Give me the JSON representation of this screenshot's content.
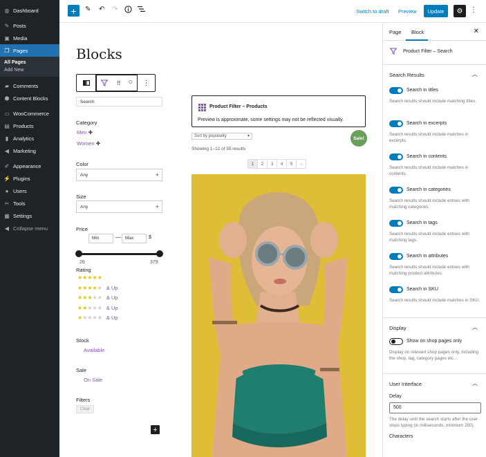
{
  "admin_menu": {
    "items": [
      {
        "label": "Dashboard",
        "icon": "dashboard-icon"
      },
      {
        "label": "Posts",
        "icon": "pin-icon"
      },
      {
        "label": "Media",
        "icon": "media-icon"
      },
      {
        "label": "Pages",
        "icon": "pages-icon"
      },
      {
        "label": "Comments",
        "icon": "comment-icon"
      },
      {
        "label": "Content Blocks",
        "icon": "blocks-icon"
      },
      {
        "label": "WooCommerce",
        "icon": "woo-icon"
      },
      {
        "label": "Products",
        "icon": "archive-icon"
      },
      {
        "label": "Analytics",
        "icon": "bar-chart-icon"
      },
      {
        "label": "Marketing",
        "icon": "megaphone-icon"
      },
      {
        "label": "Appearance",
        "icon": "brush-icon"
      },
      {
        "label": "Plugins",
        "icon": "plug-icon"
      },
      {
        "label": "Users",
        "icon": "user-icon"
      },
      {
        "label": "Tools",
        "icon": "wrench-icon"
      },
      {
        "label": "Settings",
        "icon": "settings-icon"
      },
      {
        "label": "Collapse menu",
        "icon": "collapse-icon"
      }
    ],
    "sub": {
      "all_pages": "All Pages",
      "add_new": "Add New"
    },
    "accent": "#2271b1"
  },
  "toolbar": {
    "switch_to_draft": "Switch to draft",
    "preview": "Preview",
    "update": "Update"
  },
  "editor": {
    "page_title": "Blocks",
    "filters": {
      "search_placeholder": "Search",
      "category": {
        "label": "Category",
        "options": [
          "Men",
          "Women"
        ]
      },
      "color": {
        "label": "Color",
        "value": "Any"
      },
      "size": {
        "label": "Size",
        "value": "Any"
      },
      "price": {
        "label": "Price",
        "min_placeholder": "Min",
        "max_placeholder": "Max",
        "currency": "$",
        "min": "26",
        "max": "379",
        "dash": "—"
      },
      "rating": {
        "label": "Rating",
        "levels": [
          5,
          4,
          3,
          2,
          1
        ],
        "and_up": "& Up"
      },
      "stock": {
        "label": "Stock",
        "option": "Available"
      },
      "sale": {
        "label": "Sale",
        "option": "On Sale"
      },
      "filters": {
        "label": "Filters",
        "clear": "Clear"
      }
    },
    "products_block": {
      "title": "Product Filter – Products",
      "note": "Preview is approximate, some settings may not be reflected visually."
    },
    "sort": "Sort by popularity",
    "sale_badge": "Sale!",
    "showing": "Showing 1–12 of 55 results",
    "pages": [
      "1",
      "2",
      "3",
      "4",
      "5",
      "→"
    ]
  },
  "settings": {
    "tabs": {
      "page": "Page",
      "block": "Block"
    },
    "block_name": "Product Filter – Search",
    "search_results": {
      "title": "Search Results",
      "toggles": [
        {
          "label": "Search in titles",
          "help": "Search results should include matching titles.",
          "on": true
        },
        {
          "label": "Search in excerpts",
          "help": "Search results should include matches in excerpts.",
          "on": true
        },
        {
          "label": "Search in contents",
          "help": "Search results should include matches in contents.",
          "on": true
        },
        {
          "label": "Search in categories",
          "help": "Search results should include entries with matching categories.",
          "on": true
        },
        {
          "label": "Search in tags",
          "help": "Search results should include entries with matching tags.",
          "on": true
        },
        {
          "label": "Search in attributes",
          "help": "Search results should include entries with matching product attributes.",
          "on": true
        },
        {
          "label": "Search in SKU",
          "help": "Search results should include matches in SKU.",
          "on": true
        }
      ]
    },
    "display": {
      "title": "Display",
      "toggle_label": "Show on shop pages only",
      "toggle_help": "Display on relevant shop pages only, including the shop, tag, category pages etc…",
      "on": false
    },
    "ui": {
      "title": "User Interface",
      "delay_label": "Delay",
      "delay_value": "500",
      "delay_help": "The delay until the search starts after the user stops typing (in milliseconds, minimum 250).",
      "characters_label": "Characters"
    }
  },
  "colors": {
    "accent": "#007cba",
    "woo_purple": "#7f54b3",
    "sale_green": "#6b9e5a",
    "star": "#e8c400"
  }
}
